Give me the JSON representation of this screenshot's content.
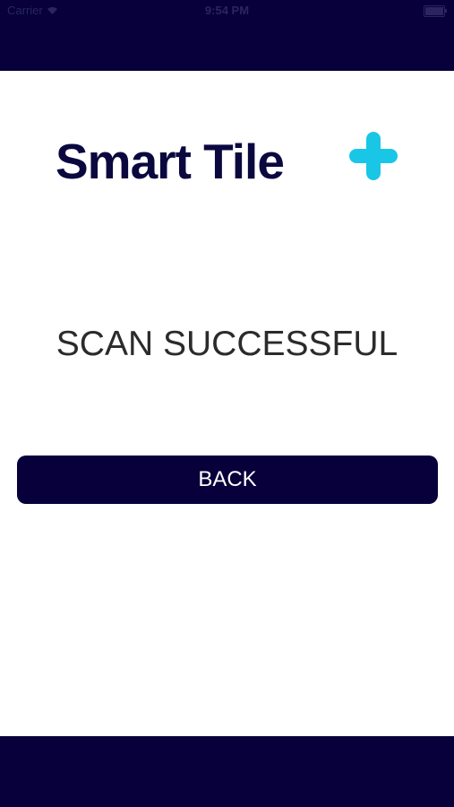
{
  "status_bar": {
    "carrier": "Carrier",
    "time": "9:54 PM"
  },
  "logo": {
    "text": "Smart Tile",
    "plus_icon": "plus-icon",
    "text_color": "#0b0840",
    "plus_color": "#19c6e6"
  },
  "message": "SCAN SUCCESSFUL",
  "back_button": {
    "label": "BACK"
  },
  "colors": {
    "bar": "#07003a",
    "background": "#ffffff"
  }
}
